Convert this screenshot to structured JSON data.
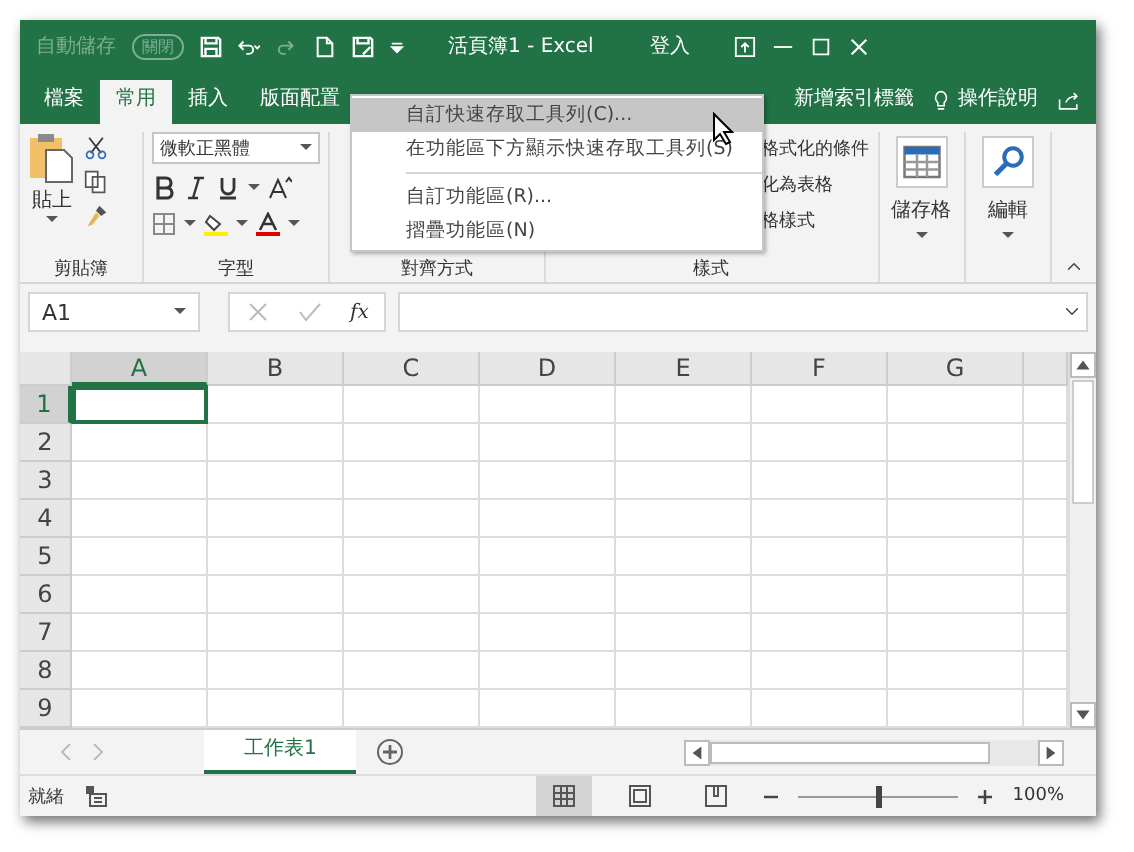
{
  "title_bar": {
    "autosave_label": "自動儲存",
    "autosave_toggle": "關閉",
    "title": "活頁簿1 - Excel",
    "sign_in": "登入"
  },
  "ribbon_tabs": [
    {
      "label": "檔案",
      "selected": false
    },
    {
      "label": "常用",
      "selected": true
    },
    {
      "label": "插入",
      "selected": false
    },
    {
      "label": "版面配置",
      "selected": false
    }
  ],
  "ribbon_tabs_right": [
    {
      "label": "新增索引標籤",
      "selected": false
    }
  ],
  "tell_me": "操作說明",
  "ribbon": {
    "paste": "貼上",
    "clipboard_group": "剪貼簿",
    "font_name": "微軟正黑體",
    "font_group": "字型",
    "alignment_group": "對齊方式",
    "style_items": [
      "格式化的條件",
      "化為表格",
      "格樣式"
    ],
    "styles_group": "樣式",
    "cells": "儲存格",
    "editing": "編輯"
  },
  "context_menu": [
    {
      "label": "自訂快速存取工具列(C)...",
      "selected": true,
      "separator_before": false
    },
    {
      "label": "在功能區下方顯示快速存取工具列(S)",
      "selected": false,
      "separator_before": false
    },
    {
      "label": "自訂功能區(R)...",
      "selected": false,
      "separator_before": true
    },
    {
      "label": "摺疊功能區(N)",
      "selected": false,
      "separator_before": false
    }
  ],
  "name_box": "A1",
  "formula_symbol": "fx",
  "columns": [
    {
      "label": "A",
      "selected": true
    },
    {
      "label": "B",
      "selected": false
    },
    {
      "label": "C",
      "selected": false
    },
    {
      "label": "D",
      "selected": false
    },
    {
      "label": "E",
      "selected": false
    },
    {
      "label": "F",
      "selected": false
    },
    {
      "label": "G",
      "selected": false
    }
  ],
  "rows": [
    {
      "label": "1",
      "selected": true
    },
    {
      "label": "2",
      "selected": false
    },
    {
      "label": "3",
      "selected": false
    },
    {
      "label": "4",
      "selected": false
    },
    {
      "label": "5",
      "selected": false
    },
    {
      "label": "6",
      "selected": false
    },
    {
      "label": "7",
      "selected": false
    },
    {
      "label": "8",
      "selected": false
    },
    {
      "label": "9",
      "selected": false
    }
  ],
  "sheet_tabs": [
    {
      "label": "工作表1",
      "selected": true
    }
  ],
  "status_bar": {
    "status": "就緒",
    "zoom": "100%",
    "zoom_slider": {
      "level": 0.5
    }
  }
}
